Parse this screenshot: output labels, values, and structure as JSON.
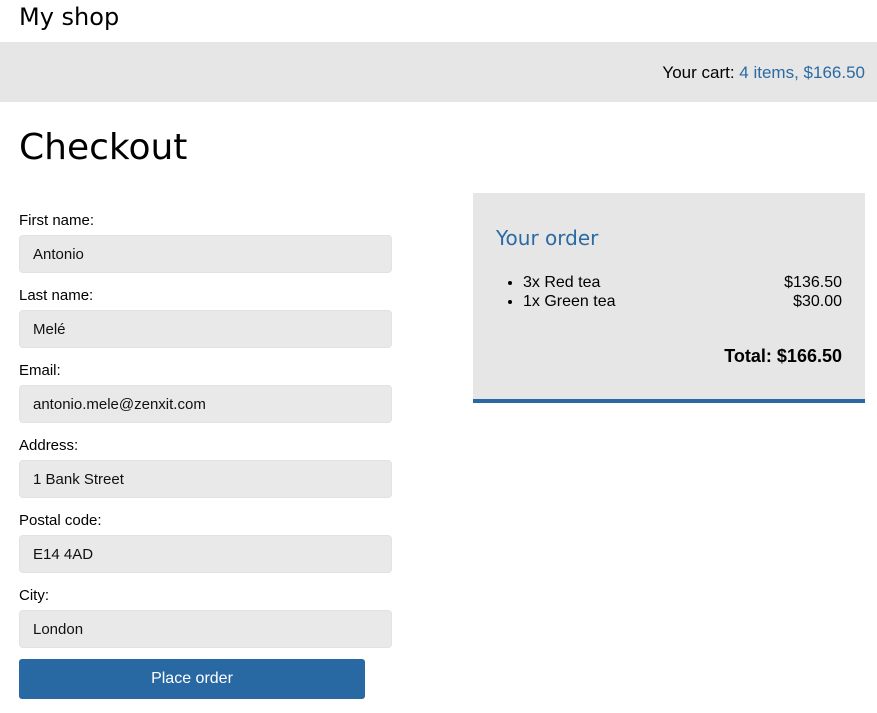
{
  "header": {
    "site_title": "My shop"
  },
  "cart": {
    "label": "Your cart:",
    "summary": "4 items, $166.50"
  },
  "page_title": "Checkout",
  "form": {
    "fields": [
      {
        "label": "First name:",
        "value": "Antonio"
      },
      {
        "label": "Last name:",
        "value": "Melé"
      },
      {
        "label": "Email:",
        "value": "antonio.mele@zenxit.com"
      },
      {
        "label": "Address:",
        "value": "1 Bank Street"
      },
      {
        "label": "Postal code:",
        "value": "E14 4AD"
      },
      {
        "label": "City:",
        "value": "London"
      }
    ],
    "submit_label": "Place order"
  },
  "order": {
    "title": "Your order",
    "items": [
      {
        "text": "3x Red tea",
        "price": "$136.50"
      },
      {
        "text": "1x Green tea",
        "price": "$30.00"
      }
    ],
    "total": "Total: $166.50"
  },
  "colors": {
    "accent": "#2869a4",
    "link": "#2b6aa3",
    "panel_background": "#e6e6e6",
    "input_background": "#e9e9e9"
  }
}
